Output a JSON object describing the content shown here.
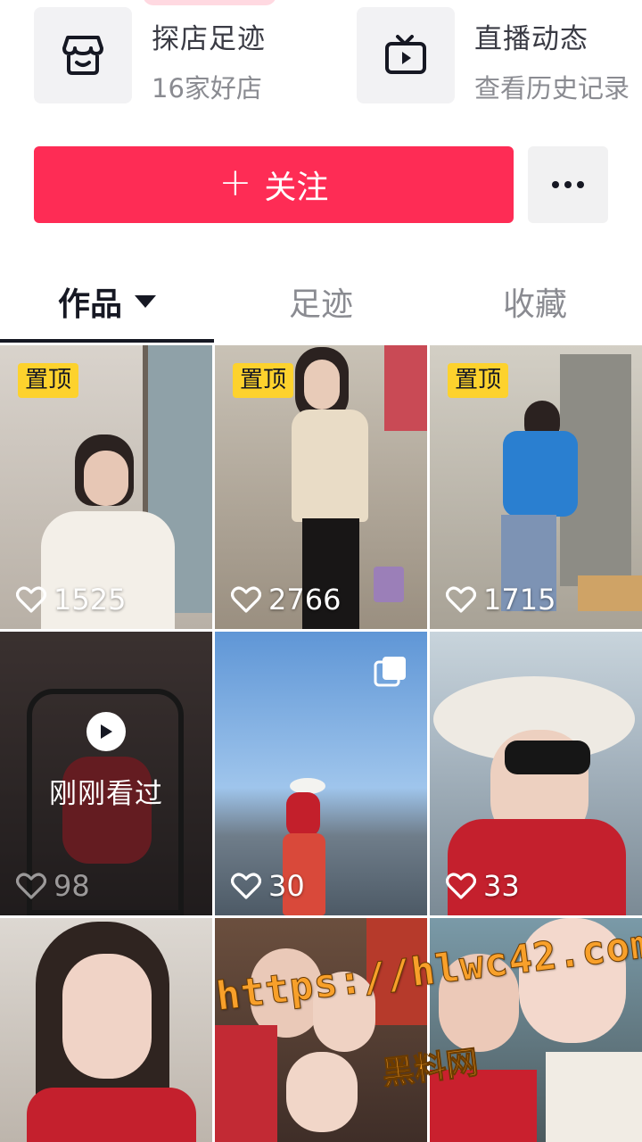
{
  "shortcuts": [
    {
      "icon": "store-icon",
      "title": "探店足迹",
      "subtitle": "16家好店"
    },
    {
      "icon": "live-tv-icon",
      "title": "直播动态",
      "subtitle": "查看历史记录"
    }
  ],
  "actions": {
    "follow_label": "关注",
    "more_icon": "more-dots-icon"
  },
  "tabs": [
    {
      "label": "作品",
      "active": true
    },
    {
      "label": "足迹",
      "active": false
    },
    {
      "label": "收藏",
      "active": false
    }
  ],
  "videos": [
    {
      "pinned_label": "置顶",
      "likes": "1525"
    },
    {
      "pinned_label": "置顶",
      "likes": "2766"
    },
    {
      "pinned_label": "置顶",
      "likes": "1715"
    },
    {
      "likes": "98",
      "overlay_label": "刚刚看过"
    },
    {
      "likes": "30",
      "multi_image": true
    },
    {
      "likes": "33"
    },
    {},
    {},
    {}
  ],
  "watermark": {
    "url": "https://hlwc42.com",
    "site": "黑料网"
  },
  "colors": {
    "accent": "#fe2c55",
    "pin_badge": "#fdd22d",
    "watermark": "#f8a02a"
  }
}
